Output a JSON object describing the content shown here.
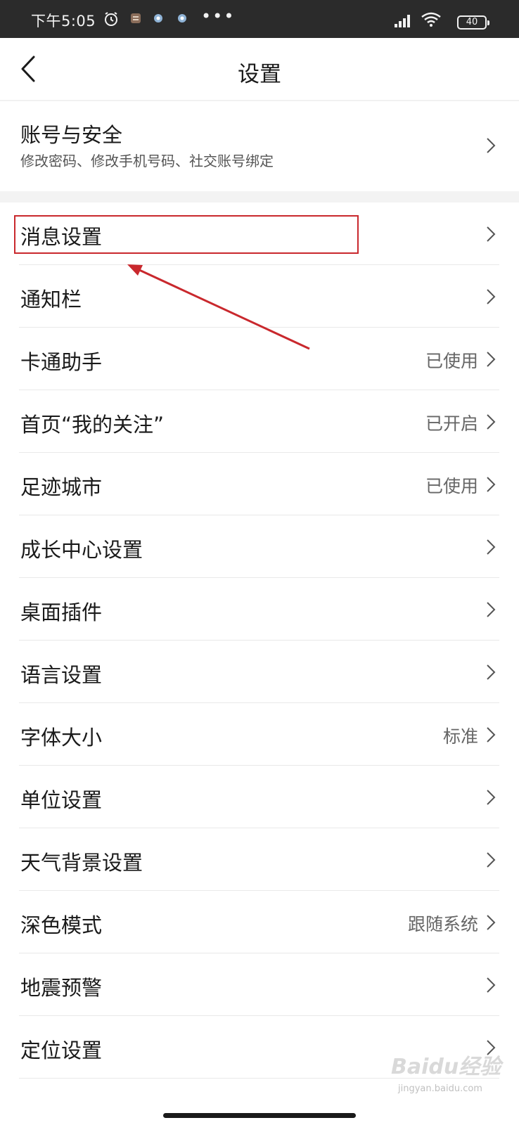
{
  "status_bar": {
    "time": "下午5:05",
    "more": "•••",
    "battery": "40"
  },
  "nav": {
    "title": "设置"
  },
  "account": {
    "title": "账号与安全",
    "subtitle": "修改密码、修改手机号码、社交账号绑定"
  },
  "settings": [
    {
      "label": "消息设置",
      "value": ""
    },
    {
      "label": "通知栏",
      "value": ""
    },
    {
      "label": "卡通助手",
      "value": "已使用"
    },
    {
      "label": "首页“我的关注”",
      "value": "已开启"
    },
    {
      "label": "足迹城市",
      "value": "已使用"
    },
    {
      "label": "成长中心设置",
      "value": ""
    },
    {
      "label": "桌面插件",
      "value": ""
    },
    {
      "label": "语言设置",
      "value": ""
    },
    {
      "label": "字体大小",
      "value": "标准"
    },
    {
      "label": "单位设置",
      "value": ""
    },
    {
      "label": "天气背景设置",
      "value": ""
    },
    {
      "label": "深色模式",
      "value": "跟随系统"
    },
    {
      "label": "地震预警",
      "value": ""
    },
    {
      "label": "定位设置",
      "value": ""
    }
  ],
  "watermark": {
    "brand": "Baidu经验",
    "url": "jingyan.baidu.com"
  },
  "colors": {
    "annotation": "#c9282d",
    "status_bar_bg": "#2b2b2b"
  }
}
